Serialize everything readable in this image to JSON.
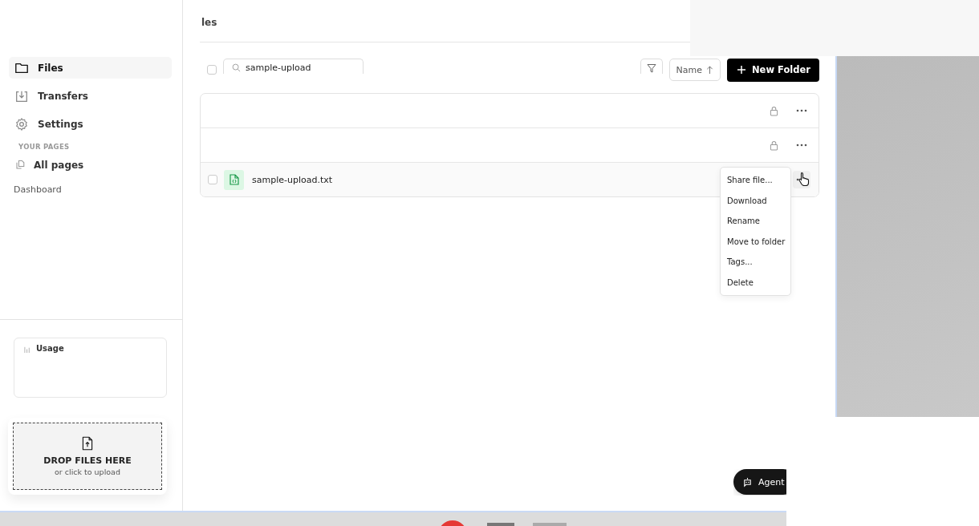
{
  "header": {
    "title": "les"
  },
  "sidebar": {
    "items": [
      {
        "label": "Files",
        "kind": "folder",
        "selected": true
      },
      {
        "label": "Transfers",
        "kind": "transfers",
        "selected": false
      },
      {
        "label": "Settings",
        "kind": "settings",
        "selected": false
      }
    ],
    "section_label": "YOUR PAGES",
    "pages": [
      {
        "label": "All pages",
        "kind": "icon"
      },
      {
        "label": "Dashboard",
        "kind": "plain"
      }
    ],
    "usage": {
      "title": "Usage"
    },
    "drop_zone": {
      "title": "DROP FILES HERE",
      "subtitle": "or click to upload"
    }
  },
  "toolbar": {
    "select_all": {
      "checked": false
    },
    "search": {
      "value": "sample-upload"
    },
    "sort": {
      "label": "Name"
    },
    "new_folder": {
      "label": "New Folder"
    }
  },
  "rows": [
    {
      "kind": "hidden",
      "hovered": false
    },
    {
      "kind": "hidden",
      "hovered": false
    },
    {
      "kind": "file",
      "name": "sample-upload.txt",
      "checked": false,
      "hovered": true
    }
  ],
  "context_menu": {
    "items": [
      "Share file...",
      "Download",
      "Rename",
      "Move to folder",
      "Tags...",
      "Delete"
    ]
  },
  "agent_button": {
    "label": "Agent"
  }
}
